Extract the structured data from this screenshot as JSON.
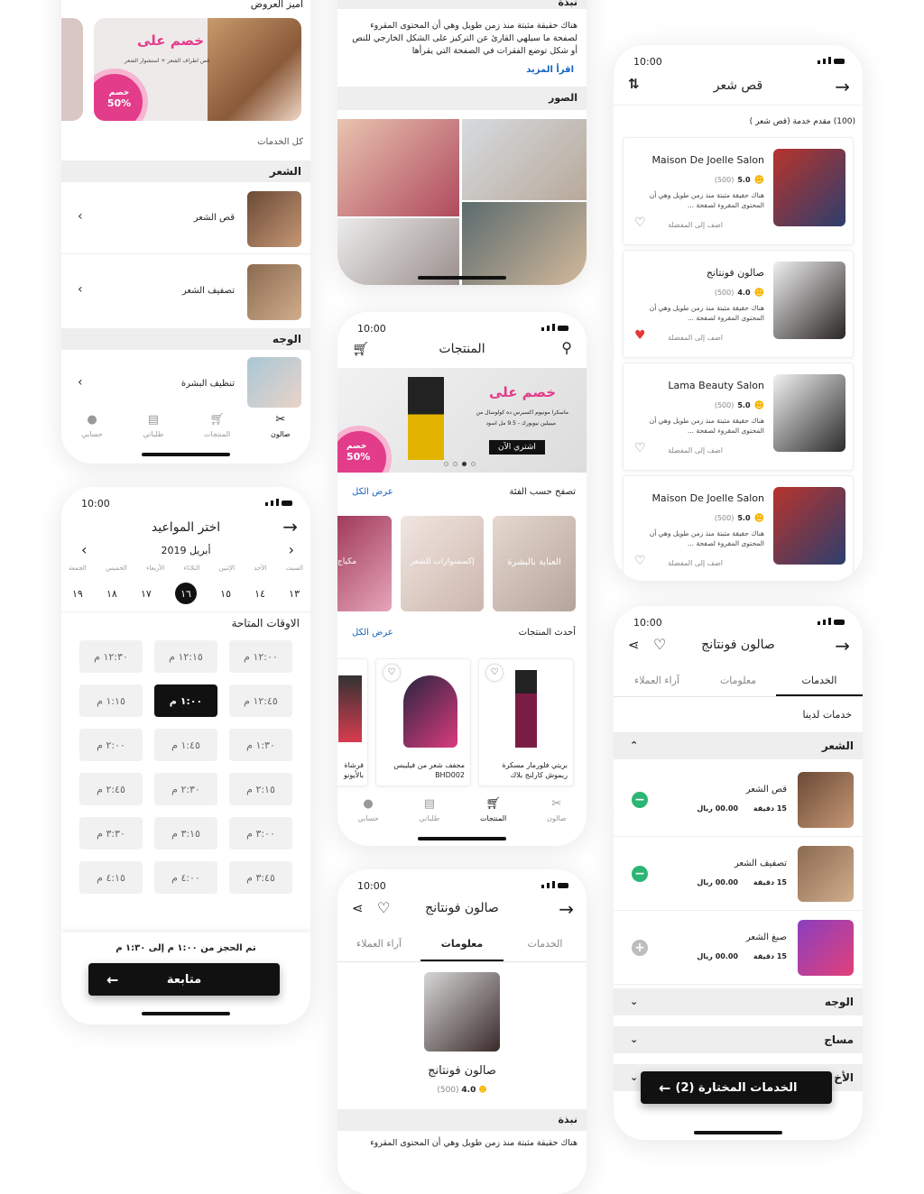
{
  "colors": {
    "accent": "#e23c8a",
    "link": "#1565c0",
    "green": "#2bb673",
    "grey": "#bdbdbd",
    "dark": "#111111"
  },
  "s1": {
    "featured_title": "اميز العروض",
    "promo": {
      "heading": "خصم على",
      "sub": "قص اطراف الشعر + استشوار الشعر",
      "badge1": "خصم",
      "badge2": "50%"
    },
    "all_services": "كل الخدمات",
    "cat_hair": "الشعر",
    "items": [
      {
        "label": "قص الشعر"
      },
      {
        "label": "تصفيف الشعر"
      }
    ],
    "cat_face": "الوجه",
    "face_item": "تنظيف البشرة",
    "nav": [
      "صالون",
      "المنتجات",
      "طلباتي",
      "حسابي"
    ]
  },
  "s2": {
    "time": "10:00",
    "title": "اختر المواعيد",
    "month": "أبريل 2019",
    "weekdays": [
      "السبت",
      "الأحد",
      "الإثنين",
      "الثلاثاء",
      "الأربعاء",
      "الخميس",
      "الجمعة"
    ],
    "dates": [
      "١٣",
      "١٤",
      "١٥",
      "١٦",
      "١٧",
      "١٨",
      "١٩"
    ],
    "available": "الاوقات المتاحة",
    "slots": [
      "١٢:٠٠ م",
      "١٢:١٥ م",
      "١٢:٣٠ م",
      "١٢:٤٥ م",
      "١:٠٠ م",
      "١:١٥ م",
      "١:٣٠ م",
      "١:٤٥ م",
      "٢:٠٠ م",
      "٢:١٥ م",
      "٢:٣٠ م",
      "٢:٤٥ م",
      "٣:٠٠ م",
      "٣:١٥ م",
      "٣:٣٠ م",
      "٣:٤٥ م",
      "٤:٠٠ م",
      "٤:١٥ م"
    ],
    "booked": "تم الحجز من ١:٠٠ م إلى ١:٣٠ م",
    "continue": "متابعة"
  },
  "s3": {
    "about_title": "نبذة",
    "about_text": "هناك حقيقة مثبتة منذ زمن طويل وهي أن المحتوى المقروء لصفحة ما سيلهي القارئ عن التركيز على الشكل الخارجي للنص أو شكل توضع الفقرات في الصفحة التي يقرأها",
    "read_more": "اقرأ المزيد",
    "photos": "الصور"
  },
  "s4": {
    "time": "10:00",
    "title": "المنتجات",
    "promo": {
      "heading": "خصم على",
      "line1": "ماسكرا مونيوم اكسبرس ده كولوسال من",
      "line2": "ميبيلين نيويورك - 9.5 مل اسود",
      "cta": "اشتري الآن",
      "badge1": "خصم",
      "badge2": "50%"
    },
    "browse": "تصفح حسب الفئة",
    "view_all": "عرض الكل",
    "cats": [
      "العناية بالبشرة",
      "إكسسوارات للشعر",
      "مكياج"
    ],
    "latest": "أحدث المنتجات",
    "products": [
      {
        "name": "بريتي فلورمار مسكرة ريموش كارلنج بلاك"
      },
      {
        "name": "مجفف شعر من فيليبس BHD002"
      },
      {
        "name": "فرشاة بالأيونو"
      }
    ],
    "nav": [
      "صالون",
      "المنتجات",
      "طلباتي",
      "حسابي"
    ]
  },
  "s5": {
    "time": "10:00",
    "title": "صالون فونتانج",
    "tabs": [
      "الخدمات",
      "معلومات",
      "آراء العملاء"
    ],
    "salon_name": "صالون فونتانج",
    "rating": "4.0",
    "reviews": "(500)",
    "about_title": "نبذة",
    "about_text": "هناك حقيقة مثبتة منذ زمن طويل وهي أن المحتوى المقروء"
  },
  "s6": {
    "time": "10:00",
    "title": "قص شعر",
    "count": "(100) مقدم خدمة (قص شعر )",
    "desc": "هناك حقيقة مثبتة منذ زمن طويل وهي أن المحتوى المقروء لصفحة ...",
    "fav": "اضف إلى المفضلة",
    "salons": [
      {
        "name": "Maison De Joelle Salon",
        "rating": "5.0",
        "reviews": "(500)",
        "fav": false
      },
      {
        "name": "صالون فونتانج",
        "rating": "4.0",
        "reviews": "(500)",
        "fav": true
      },
      {
        "name": "Lama Beauty Salon",
        "rating": "5.0",
        "reviews": "(500)",
        "fav": false
      },
      {
        "name": "Maison De Joelle Salon",
        "rating": "5.0",
        "reviews": "(500)",
        "fav": false
      }
    ]
  },
  "s7": {
    "time": "10:00",
    "title": "صالون فونتانج",
    "tabs": [
      "الخدمات",
      "معلومات",
      "آراء العملاء"
    ],
    "our_services": "خدمات لدينا",
    "cat_hair": "الشعر",
    "services": [
      {
        "name": "قص الشعر",
        "duration": "15 دقيقة",
        "price": "00.00 ريال",
        "state": "remove"
      },
      {
        "name": "تصفيف الشعر",
        "duration": "15 دقيقة",
        "price": "00.00 ريال",
        "state": "remove"
      },
      {
        "name": "صبغ الشعر",
        "duration": "15 دقيقة",
        "price": "00.00 ريال",
        "state": "add"
      }
    ],
    "cat_face": "الوجه",
    "cat_massage": "مساج",
    "cat_other": "الأخ",
    "selected_btn": "(2) الخدمات المختارة"
  }
}
